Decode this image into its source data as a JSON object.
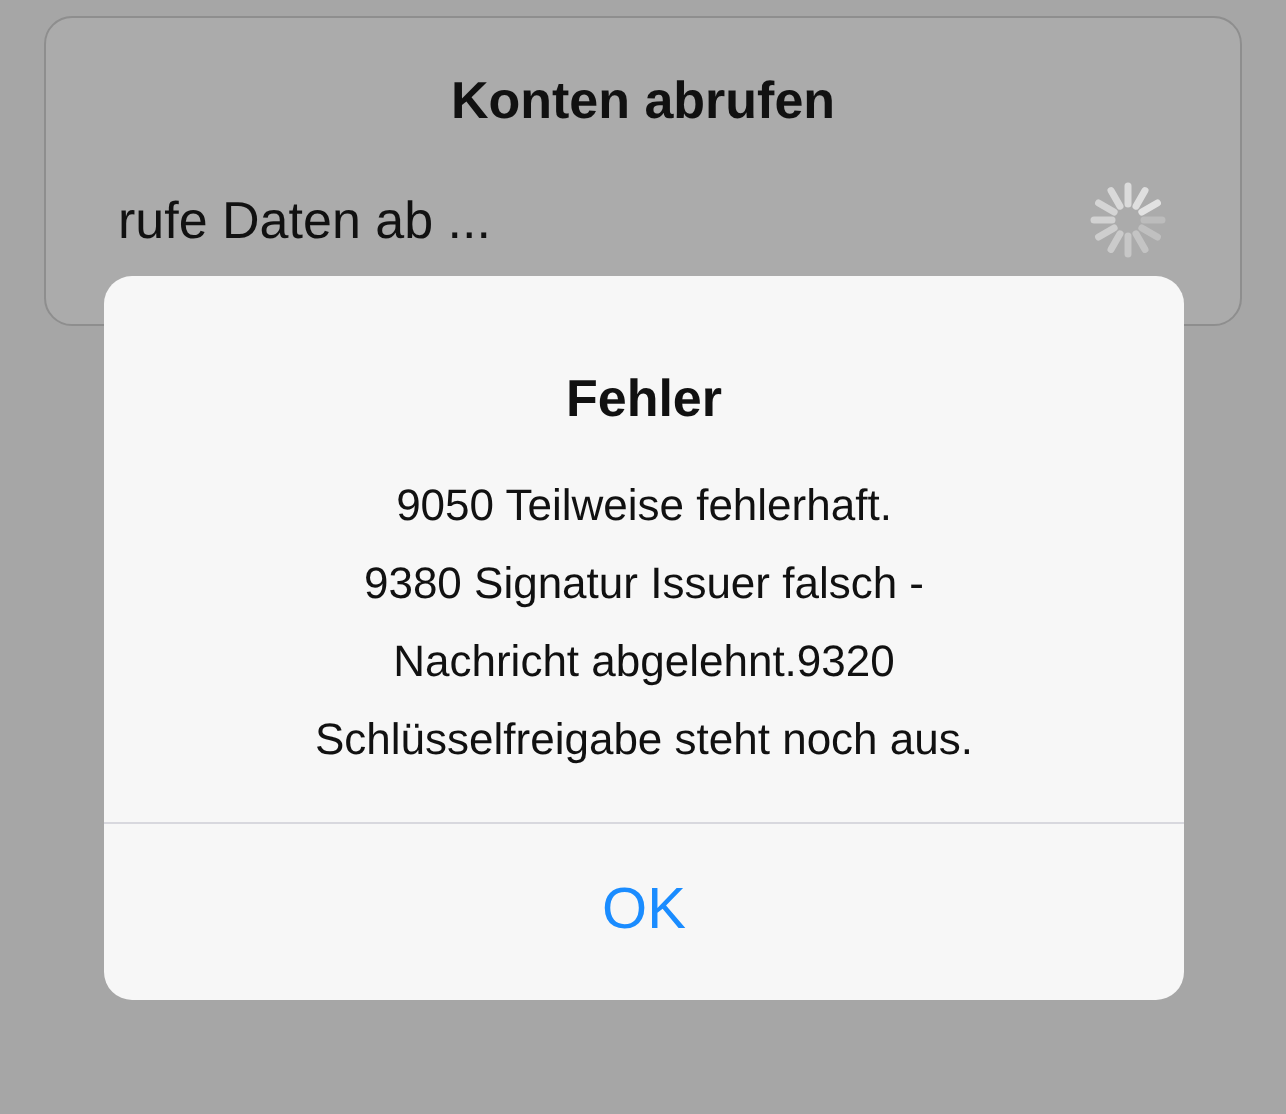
{
  "sheet": {
    "title": "Konten abrufen",
    "status": "rufe Daten ab ..."
  },
  "alert": {
    "title": "Fehler",
    "message": [
      "9050 Teilweise fehlerhaft.",
      "9380 Signatur Issuer falsch -",
      "Nachricht abgelehnt.9320",
      "Schlüsselfreigabe steht noch aus."
    ],
    "buttons": [
      "OK"
    ]
  }
}
